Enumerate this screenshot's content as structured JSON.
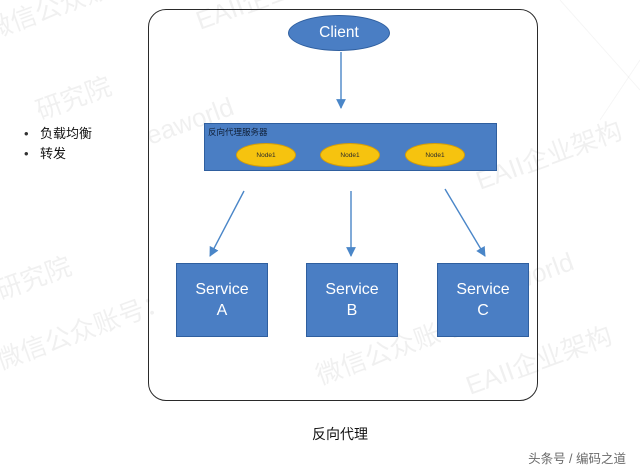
{
  "bullets": [
    "负载均衡",
    "转发"
  ],
  "client": {
    "label": "Client"
  },
  "proxy": {
    "label": "反向代理服务器",
    "nodes": [
      "Node1",
      "Node1",
      "Node1"
    ]
  },
  "services": [
    {
      "line1": "Service",
      "line2": "A"
    },
    {
      "line1": "Service",
      "line2": "B"
    },
    {
      "line1": "Service",
      "line2": "C"
    }
  ],
  "caption": "反向代理",
  "footer": "头条号 / 编码之道",
  "watermark": {
    "texts": [
      "微信公众账号：",
      "EAII企业架构",
      "研究院",
      "eaworld",
      "EAII企业架构",
      "微信公众账号：",
      "研究院",
      "eaworld",
      "微信公众账号：",
      "EAII企业架构"
    ]
  },
  "colors": {
    "box_fill": "#4a7ec4",
    "box_border": "#2f5f9f",
    "node_fill": "#f6c30f",
    "arrow": "#4a86c8"
  }
}
